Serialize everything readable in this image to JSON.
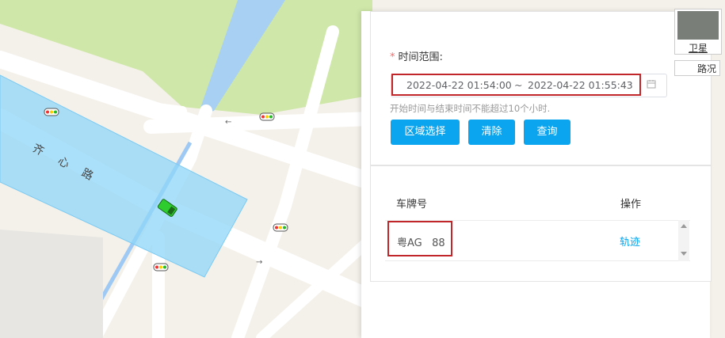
{
  "map": {
    "road_name": [
      "齐",
      "心",
      "路"
    ],
    "road_arrow": "←",
    "road_arrow_2": "→"
  },
  "form": {
    "required_mark": "*",
    "time_label": "时间范围:",
    "start_time": "2022-04-22 01:54:00",
    "separator": "~",
    "end_time": "2022-04-22 01:55:43",
    "hint": "开始时间与结束时间不能超过10个小时.",
    "buttons": {
      "region_select": "区域选择",
      "clear": "清除",
      "query": "查询"
    }
  },
  "table": {
    "headers": {
      "plate": "车牌号",
      "action": "操作"
    },
    "rows": [
      {
        "plate": "粤AG   88",
        "action": "轨迹"
      }
    ]
  },
  "map_controls": {
    "satellite": "卫星",
    "traffic": "路况"
  },
  "colors": {
    "accent": "#0aa5ee",
    "highlight": "#c0262a",
    "region": "#8fd6f8",
    "vehicle": "#2ecc2e"
  }
}
